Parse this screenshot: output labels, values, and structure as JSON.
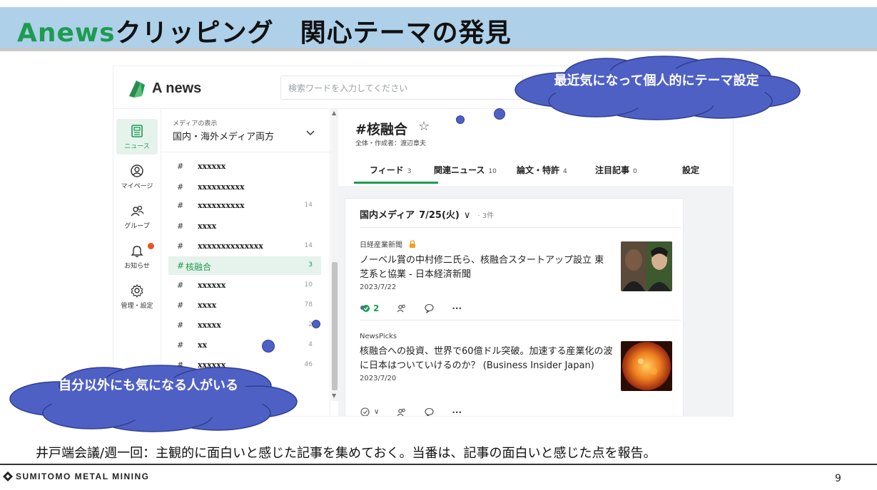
{
  "slide": {
    "title_brand": "Anews",
    "title_rest": "クリッピング　関心テーマの発見",
    "bottom_text": "井戸端会議/週一回：主観的に面白いと感じた記事を集めておく。当番は、記事の面白いと感じた点を報告。",
    "footer_brand": "SUMITOMO METAL MINING",
    "page_number": "9"
  },
  "app": {
    "logo_text": "A news",
    "search_placeholder": "検索ワードを入力してください",
    "nav": [
      {
        "label": "ニュース",
        "icon": "news-icon",
        "active": true
      },
      {
        "label": "マイページ",
        "icon": "user-icon",
        "active": false
      },
      {
        "label": "グループ",
        "icon": "group-icon",
        "active": false
      },
      {
        "label": "お知らせ",
        "icon": "bell-icon",
        "active": false
      },
      {
        "label": "管理・設定",
        "icon": "gear-icon",
        "active": false
      }
    ],
    "media_filter": {
      "caption": "メディアの表示",
      "value": "国内・海外メディア両方"
    },
    "themes": [
      {
        "hash": "#",
        "name": "xxxxxx",
        "count": ""
      },
      {
        "hash": "#",
        "name": "xxxxxxxxxx",
        "count": ""
      },
      {
        "hash": "#",
        "name": "xxxxxxxxxx",
        "count": "14"
      },
      {
        "hash": "#",
        "name": "xxxx",
        "count": ""
      },
      {
        "hash": "#",
        "name": "xxxxxxxxxxxxxx",
        "count": "14"
      },
      {
        "hash": "#",
        "name": "核融合",
        "count": "3",
        "active": true
      },
      {
        "hash": "#",
        "name": "xxxxxx",
        "count": "10"
      },
      {
        "hash": "#",
        "name": "xxxx",
        "count": "78"
      },
      {
        "hash": "#",
        "name": "xxxxx",
        "count": "2"
      },
      {
        "hash": "#",
        "name": "xx",
        "count": "4"
      },
      {
        "hash": "#",
        "name": "xxxxxx",
        "count": "46"
      }
    ],
    "theme_header": {
      "title": "#核融合",
      "meta": "全体・作成者：渡辺章夫"
    },
    "tabs": [
      {
        "label": "フィード",
        "count": "3"
      },
      {
        "label": "関連ニュース",
        "count": "10"
      },
      {
        "label": "論文・特許",
        "count": "4"
      },
      {
        "label": "注目記事",
        "count": "0"
      },
      {
        "label": "設定",
        "count": ""
      }
    ],
    "feed": {
      "group_label": "国内メディア",
      "date": "7/25(火)",
      "count_label": "· 3件",
      "articles": [
        {
          "source": "日経産業新聞",
          "title": "ノーベル賞の中村修二氏ら、核融合スタートアップ設立 東芝系と協業 - 日本経済新聞",
          "date": "2023/7/22",
          "likes": "2"
        },
        {
          "source": "NewsPicks",
          "title": "核融合への投資、世界で60億ドル突破。加速する産業化の波に日本はついていけるのか？ (Business Insider Japan)",
          "date": "2023/7/20",
          "likes": ""
        }
      ]
    }
  },
  "callouts": {
    "top": "最近気になって個人的にテーマ設定",
    "bottom": "自分以外にも気になる人がいる"
  },
  "colors": {
    "header_band": "#aed0e9",
    "brand_green": "#1d9c51",
    "cloud_fill": "#4f60c5",
    "notify_dot": "#e9542b"
  }
}
